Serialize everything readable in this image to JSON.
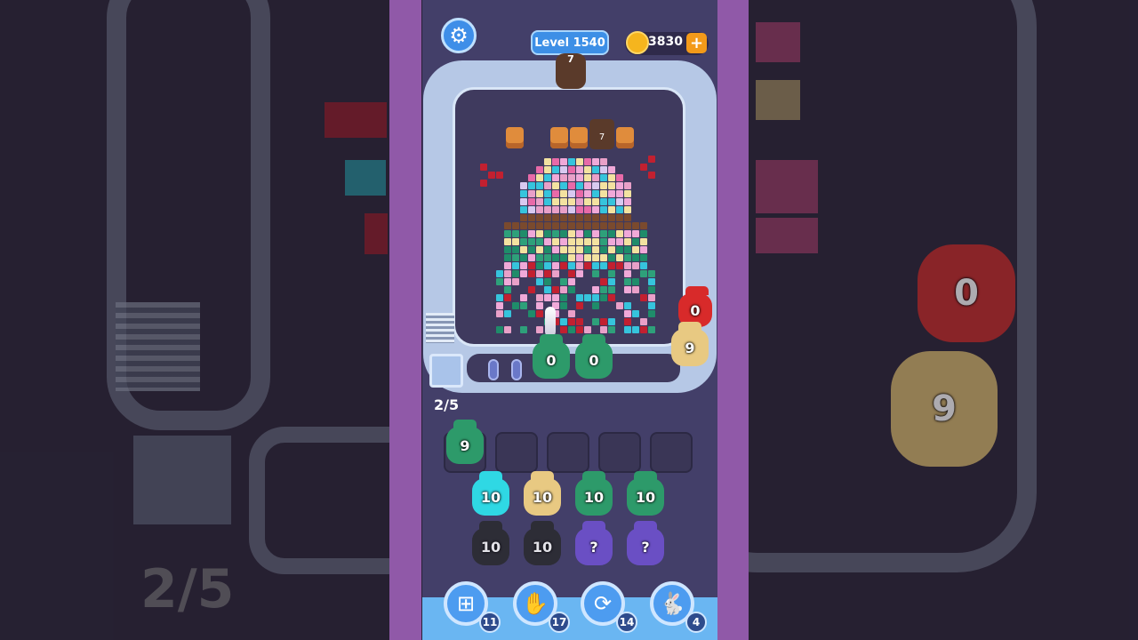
{
  "header": {
    "settings_icon": "gear-icon",
    "level_label": "Level 1540",
    "coins": "3830",
    "add_coins_icon": "plus-icon"
  },
  "board": {
    "top_dark_block_count": "7",
    "pixel_dark_block_count": "7",
    "conveyor_creatures": [
      {
        "count": "0",
        "color": "#2d9a6a"
      },
      {
        "count": "0",
        "color": "#2d9a6a"
      },
      {
        "count": "0",
        "color": "#d82a2a"
      },
      {
        "count": "9",
        "color": "#e8c982"
      }
    ],
    "progress": "2/5"
  },
  "holding_slots": [
    {
      "count": "9",
      "color": "#2d9a6a"
    },
    {
      "count": "",
      "color": ""
    },
    {
      "count": "",
      "color": ""
    },
    {
      "count": "",
      "color": ""
    },
    {
      "count": "",
      "color": ""
    }
  ],
  "queue": {
    "row1": [
      {
        "count": "10",
        "color": "#2fd8e4"
      },
      {
        "count": "10",
        "color": "#e8c982"
      },
      {
        "count": "10",
        "color": "#2d9a6a"
      },
      {
        "count": "10",
        "color": "#2d9a6a"
      }
    ],
    "row2": [
      {
        "count": "10",
        "color": "#2a2a2e"
      },
      {
        "count": "10",
        "color": "#2a2a2e"
      },
      {
        "count": "?",
        "color": "#6a4fc4"
      },
      {
        "count": "?",
        "color": "#6a4fc4"
      }
    ]
  },
  "boosters": [
    {
      "icon": "add-box-icon",
      "count": "11"
    },
    {
      "icon": "hand-icon",
      "count": "17"
    },
    {
      "icon": "refresh-icon",
      "count": "14"
    },
    {
      "icon": "rabbit-icon",
      "count": "4"
    }
  ],
  "backdrop": {
    "progress_text": "2/5",
    "creature_count_red": "0",
    "creature_count_yellow": "9"
  }
}
